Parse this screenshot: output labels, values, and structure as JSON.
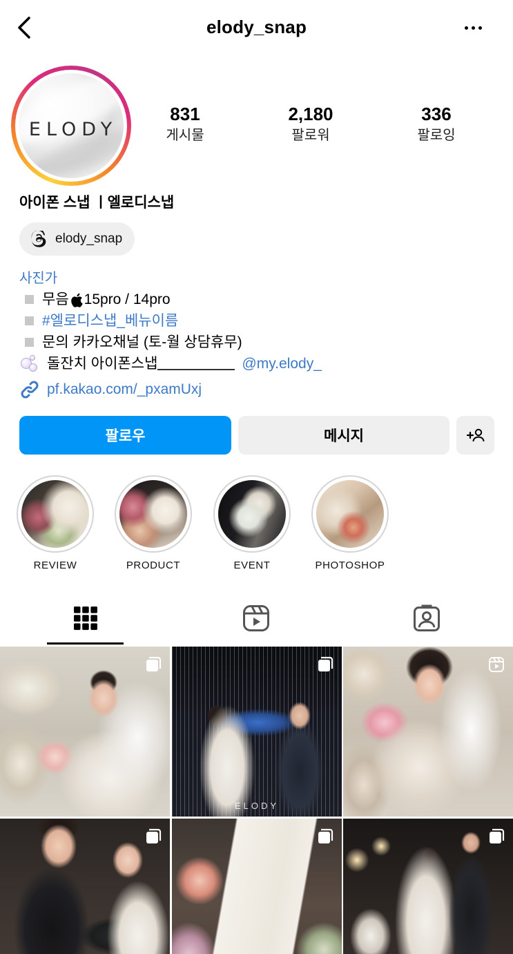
{
  "header": {
    "username": "elody_snap",
    "back_icon": "chevron-left-icon",
    "more_icon": "more-horizontal-icon"
  },
  "profile": {
    "avatar_text": "ELODY",
    "stats": [
      {
        "value": "831",
        "label": "게시물"
      },
      {
        "value": "2,180",
        "label": "팔로워"
      },
      {
        "value": "336",
        "label": "팔로잉"
      }
    ],
    "display_name": "아이폰 스냅 ㅣ엘로디스냅",
    "threads_handle": "elody_snap",
    "category": "사진가",
    "bio": {
      "line1": "무음 ",
      "line1_apple": "",
      "line1_rest": " 15pro / 14pro",
      "line2_hashtag": "#엘로디스냅_베뉴이름",
      "line3": "문의 카카오채널 (토-월 상담휴무)",
      "line4": "돌잔치 아이폰스냅",
      "line4_mention": "@my.elody_"
    },
    "link": "pf.kakao.com/_pxamUxj"
  },
  "actions": {
    "follow_label": "팔로우",
    "message_label": "메시지"
  },
  "highlights": [
    {
      "label": "REVIEW"
    },
    {
      "label": "PRODUCT"
    },
    {
      "label": "EVENT"
    },
    {
      "label": "PHOTOSHOP"
    }
  ],
  "tabs": [
    {
      "name": "posts",
      "icon": "grid-icon",
      "active": true
    },
    {
      "name": "reels",
      "icon": "reels-icon",
      "active": false
    },
    {
      "name": "tagged",
      "icon": "tagged-user-icon",
      "active": false
    }
  ],
  "posts": [
    {
      "type": "carousel",
      "watermark": ""
    },
    {
      "type": "carousel",
      "watermark": "ELODY"
    },
    {
      "type": "reel",
      "watermark": ""
    },
    {
      "type": "carousel",
      "watermark": ""
    },
    {
      "type": "carousel",
      "watermark": ""
    },
    {
      "type": "carousel",
      "watermark": ""
    }
  ],
  "colors": {
    "accent": "#0095f6",
    "link": "#3d7ac7",
    "secondary_button": "#efefef"
  }
}
